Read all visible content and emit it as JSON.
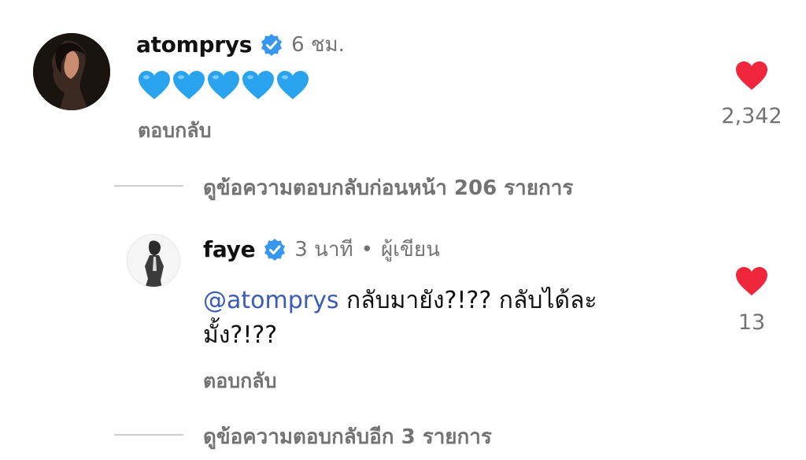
{
  "comment": {
    "username": "atomprys",
    "time": "6 ชม.",
    "reply_label": "ตอบกลับ",
    "like_count": "2,342",
    "content_icons": [
      "blue-heart",
      "blue-heart",
      "blue-heart",
      "blue-heart",
      "blue-heart"
    ]
  },
  "view_previous_replies": "ดูข้อความตอบกลับก่อนหน้า 206 รายการ",
  "reply": {
    "username": "faye",
    "time": "3 นาที",
    "separator": "•",
    "author_badge": "ผู้เขียน",
    "mention": "@atomprys",
    "text_line1": " กลับมายัง?!?? กลับได้ละ",
    "text_line2": "มั้ง?!??",
    "reply_label": "ตอบกลับ",
    "like_count": "13"
  },
  "view_more_replies": "ดูข้อความตอบกลับอีก 3 รายการ",
  "colors": {
    "like_red": "#f0263c",
    "blue_heart": "#2aa3ef",
    "verified_blue": "#3797f0",
    "secondary_text": "#737373",
    "mention": "#3a5bb8"
  }
}
